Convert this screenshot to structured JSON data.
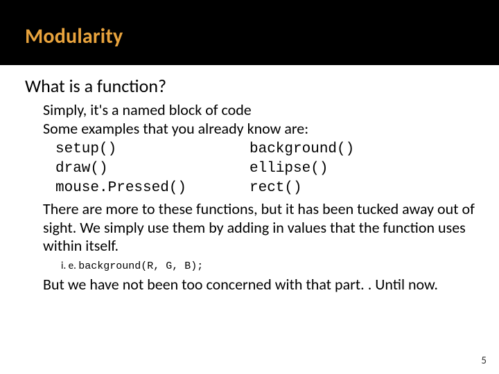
{
  "header": {
    "title": "Modularity"
  },
  "main": {
    "question": "What is a function?",
    "line1": "Simply, it's a named block of code",
    "line2": "Some examples that you already know are:",
    "functions": {
      "col1": [
        "setup()",
        "draw()",
        "mouse.Pressed()"
      ],
      "col2": [
        "background()",
        "ellipse()",
        "rect()"
      ]
    },
    "tucked": "There are more to these functions, but it has been tucked away out of sight. We simply use them by adding in values that the function uses within itself.",
    "example_prefix": "i. e. ",
    "example_code": "background(R, G, B);",
    "closing": "But we have not been too concerned with that part. . Until now."
  },
  "page_number": "5"
}
